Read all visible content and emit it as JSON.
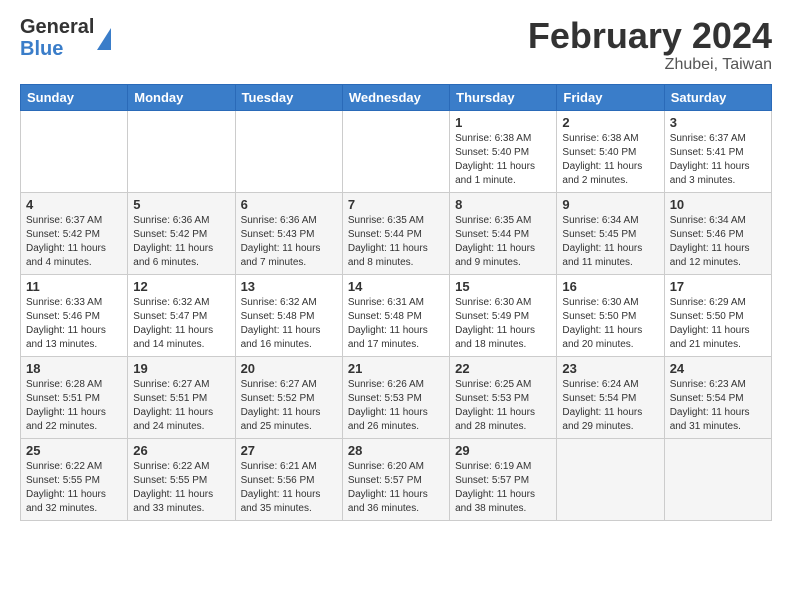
{
  "header": {
    "logo_general": "General",
    "logo_blue": "Blue",
    "month_year": "February 2024",
    "location": "Zhubei, Taiwan"
  },
  "weekdays": [
    "Sunday",
    "Monday",
    "Tuesday",
    "Wednesday",
    "Thursday",
    "Friday",
    "Saturday"
  ],
  "weeks": [
    [
      {
        "date": "",
        "info": ""
      },
      {
        "date": "",
        "info": ""
      },
      {
        "date": "",
        "info": ""
      },
      {
        "date": "",
        "info": ""
      },
      {
        "date": "1",
        "info": "Sunrise: 6:38 AM\nSunset: 5:40 PM\nDaylight: 11 hours and 1 minute."
      },
      {
        "date": "2",
        "info": "Sunrise: 6:38 AM\nSunset: 5:40 PM\nDaylight: 11 hours and 2 minutes."
      },
      {
        "date": "3",
        "info": "Sunrise: 6:37 AM\nSunset: 5:41 PM\nDaylight: 11 hours and 3 minutes."
      }
    ],
    [
      {
        "date": "4",
        "info": "Sunrise: 6:37 AM\nSunset: 5:42 PM\nDaylight: 11 hours and 4 minutes."
      },
      {
        "date": "5",
        "info": "Sunrise: 6:36 AM\nSunset: 5:42 PM\nDaylight: 11 hours and 6 minutes."
      },
      {
        "date": "6",
        "info": "Sunrise: 6:36 AM\nSunset: 5:43 PM\nDaylight: 11 hours and 7 minutes."
      },
      {
        "date": "7",
        "info": "Sunrise: 6:35 AM\nSunset: 5:44 PM\nDaylight: 11 hours and 8 minutes."
      },
      {
        "date": "8",
        "info": "Sunrise: 6:35 AM\nSunset: 5:44 PM\nDaylight: 11 hours and 9 minutes."
      },
      {
        "date": "9",
        "info": "Sunrise: 6:34 AM\nSunset: 5:45 PM\nDaylight: 11 hours and 11 minutes."
      },
      {
        "date": "10",
        "info": "Sunrise: 6:34 AM\nSunset: 5:46 PM\nDaylight: 11 hours and 12 minutes."
      }
    ],
    [
      {
        "date": "11",
        "info": "Sunrise: 6:33 AM\nSunset: 5:46 PM\nDaylight: 11 hours and 13 minutes."
      },
      {
        "date": "12",
        "info": "Sunrise: 6:32 AM\nSunset: 5:47 PM\nDaylight: 11 hours and 14 minutes."
      },
      {
        "date": "13",
        "info": "Sunrise: 6:32 AM\nSunset: 5:48 PM\nDaylight: 11 hours and 16 minutes."
      },
      {
        "date": "14",
        "info": "Sunrise: 6:31 AM\nSunset: 5:48 PM\nDaylight: 11 hours and 17 minutes."
      },
      {
        "date": "15",
        "info": "Sunrise: 6:30 AM\nSunset: 5:49 PM\nDaylight: 11 hours and 18 minutes."
      },
      {
        "date": "16",
        "info": "Sunrise: 6:30 AM\nSunset: 5:50 PM\nDaylight: 11 hours and 20 minutes."
      },
      {
        "date": "17",
        "info": "Sunrise: 6:29 AM\nSunset: 5:50 PM\nDaylight: 11 hours and 21 minutes."
      }
    ],
    [
      {
        "date": "18",
        "info": "Sunrise: 6:28 AM\nSunset: 5:51 PM\nDaylight: 11 hours and 22 minutes."
      },
      {
        "date": "19",
        "info": "Sunrise: 6:27 AM\nSunset: 5:51 PM\nDaylight: 11 hours and 24 minutes."
      },
      {
        "date": "20",
        "info": "Sunrise: 6:27 AM\nSunset: 5:52 PM\nDaylight: 11 hours and 25 minutes."
      },
      {
        "date": "21",
        "info": "Sunrise: 6:26 AM\nSunset: 5:53 PM\nDaylight: 11 hours and 26 minutes."
      },
      {
        "date": "22",
        "info": "Sunrise: 6:25 AM\nSunset: 5:53 PM\nDaylight: 11 hours and 28 minutes."
      },
      {
        "date": "23",
        "info": "Sunrise: 6:24 AM\nSunset: 5:54 PM\nDaylight: 11 hours and 29 minutes."
      },
      {
        "date": "24",
        "info": "Sunrise: 6:23 AM\nSunset: 5:54 PM\nDaylight: 11 hours and 31 minutes."
      }
    ],
    [
      {
        "date": "25",
        "info": "Sunrise: 6:22 AM\nSunset: 5:55 PM\nDaylight: 11 hours and 32 minutes."
      },
      {
        "date": "26",
        "info": "Sunrise: 6:22 AM\nSunset: 5:55 PM\nDaylight: 11 hours and 33 minutes."
      },
      {
        "date": "27",
        "info": "Sunrise: 6:21 AM\nSunset: 5:56 PM\nDaylight: 11 hours and 35 minutes."
      },
      {
        "date": "28",
        "info": "Sunrise: 6:20 AM\nSunset: 5:57 PM\nDaylight: 11 hours and 36 minutes."
      },
      {
        "date": "29",
        "info": "Sunrise: 6:19 AM\nSunset: 5:57 PM\nDaylight: 11 hours and 38 minutes."
      },
      {
        "date": "",
        "info": ""
      },
      {
        "date": "",
        "info": ""
      }
    ]
  ]
}
